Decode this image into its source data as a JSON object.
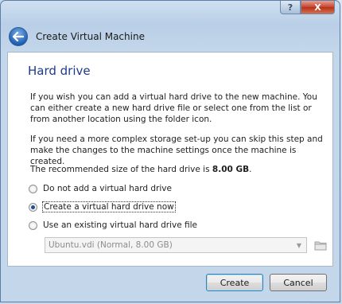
{
  "window": {
    "title": "Create Virtual Machine",
    "help_glyph": "?",
    "close_glyph": "X"
  },
  "page": {
    "heading": "Hard drive",
    "paragraph1": "If you wish you can add a virtual hard drive to the new machine. You can either create a new hard drive file or select one from the list or from another location using the folder icon.",
    "paragraph2": "If you need a more complex storage set-up you can skip this step and make the changes to the machine settings once the machine is created.",
    "recommended_prefix": "The recommended size of the hard drive is",
    "recommended_size": "8.00 GB",
    "recommended_suffix": "."
  },
  "options": {
    "no_drive": "Do not add a virtual hard drive",
    "create_new": "Create a virtual hard drive now",
    "use_existing": "Use an existing virtual hard drive file",
    "selected": "create_new"
  },
  "existing_file": {
    "value": "Ubuntu.vdi (Normal, 8.00 GB)"
  },
  "buttons": {
    "create": "Create",
    "cancel": "Cancel"
  },
  "icons": {
    "back": "back-arrow-icon",
    "folder": "folder-icon",
    "dropdown": "chevron-down-icon"
  }
}
